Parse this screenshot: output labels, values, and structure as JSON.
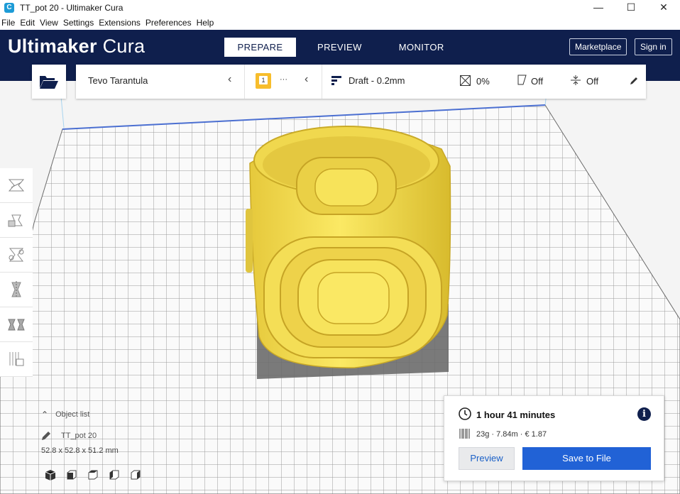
{
  "window": {
    "title": "TT_pot 20 - Ultimaker Cura",
    "app_icon_letter": "C",
    "controls": {
      "minimize": "—",
      "maximize": "☐",
      "close": "✕"
    }
  },
  "menu": [
    "File",
    "Edit",
    "View",
    "Settings",
    "Extensions",
    "Preferences",
    "Help"
  ],
  "header": {
    "logo_brand": "Ultimaker",
    "logo_product": "Cura",
    "tabs": [
      "PREPARE",
      "PREVIEW",
      "MONITOR"
    ],
    "active_tab": "PREPARE",
    "marketplace_label": "Marketplace",
    "signin_label": "Sign in",
    "background_color": "#0f1f4d"
  },
  "toolbar": {
    "printer_name": "Tevo Tarantula",
    "extruder_number": "1",
    "extruder_dots": "···",
    "profile": "Draft - 0.2mm",
    "infill": "0%",
    "support": "Off",
    "adhesion": "Off"
  },
  "object": {
    "list_label": "Object list",
    "name": "TT_pot 20",
    "dimensions": "52.8 x 52.8 x 51.2 mm",
    "model_color": "#f5e157"
  },
  "print_panel": {
    "time": "1 hour 41 minutes",
    "material": "23g · 7.84m · € 1.87",
    "preview_label": "Preview",
    "save_label": "Save to File",
    "accent_color": "#2162d6"
  },
  "icons": {
    "open": "folder-open-icon",
    "tools": [
      "move-tool-icon",
      "scale-tool-icon",
      "rotate-tool-icon",
      "mirror-tool-icon",
      "per-model-settings-icon",
      "support-blocker-icon"
    ],
    "views": [
      "3d-view-icon",
      "front-view-icon",
      "top-view-icon",
      "left-view-icon",
      "right-view-icon"
    ]
  }
}
